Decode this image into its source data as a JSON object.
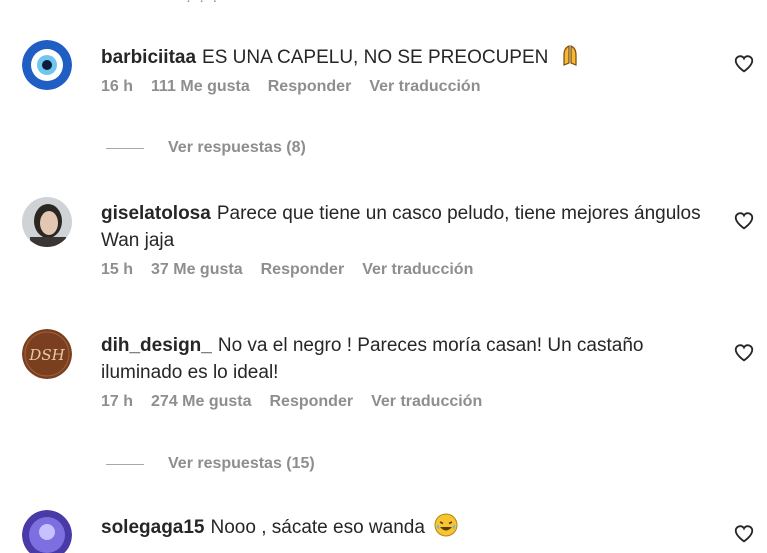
{
  "top_fragment": "· · ·",
  "comments": [
    {
      "username": "barbiciitaa",
      "text": "ES UNA CAPELU, NO SE PREOCUPEN",
      "emoji": "pray-emoji",
      "time": "16 h",
      "likes": "111 Me gusta",
      "reply": "Responder",
      "translate": "Ver traducción",
      "view_replies": "Ver respuestas (8)"
    },
    {
      "username": "giselatolosa",
      "text": "Parece que tiene un casco peludo, tiene mejores ángulos Wan jaja",
      "time": "15 h",
      "likes": "37 Me gusta",
      "reply": "Responder",
      "translate": "Ver traducción"
    },
    {
      "username": "dih_design_",
      "text": "No va el negro ! Pareces moría casan! Un castaño iluminado es lo ideal!",
      "time": "17 h",
      "likes": "274 Me gusta",
      "reply": "Responder",
      "translate": "Ver traducción",
      "view_replies": "Ver respuestas (15)"
    },
    {
      "username": "solegaga15",
      "text": "Nooo , sácate eso wanda",
      "emoji": "laughing-emoji"
    }
  ],
  "colors": {
    "text": "#262626",
    "secondary": "#8e8e8e",
    "evil_eye_blue": "#1f5fc4"
  }
}
